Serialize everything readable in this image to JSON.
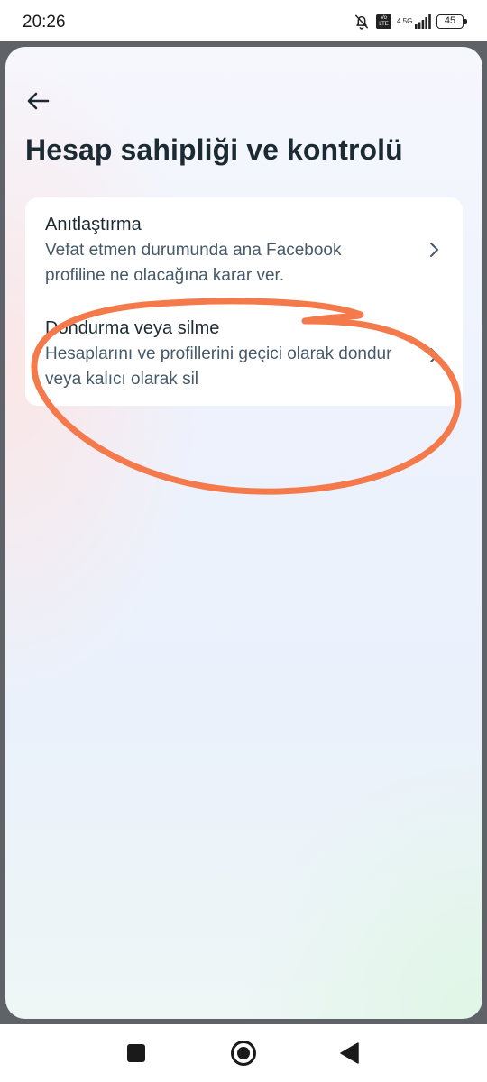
{
  "status_bar": {
    "time": "20:26",
    "volte": "Vo LTE",
    "network": "4.5G",
    "battery": "45"
  },
  "header": {
    "title": "Hesap sahipliği ve kontrolü"
  },
  "menu": {
    "items": [
      {
        "title": "Anıtlaştırma",
        "description": "Vefat etmen durumunda ana Facebook profiline ne olacağına karar ver."
      },
      {
        "title": "Dondurma veya silme",
        "description": "Hesaplarını ve profillerini geçici olarak dondur veya kalıcı olarak sil"
      }
    ]
  },
  "colors": {
    "annotation": "#f47a4c",
    "title_text": "#1c2b33",
    "secondary_text": "#465a69"
  },
  "icons": [
    "bell-off-icon",
    "signal-icon",
    "battery-icon",
    "back-arrow-icon",
    "chevron-right-icon"
  ]
}
